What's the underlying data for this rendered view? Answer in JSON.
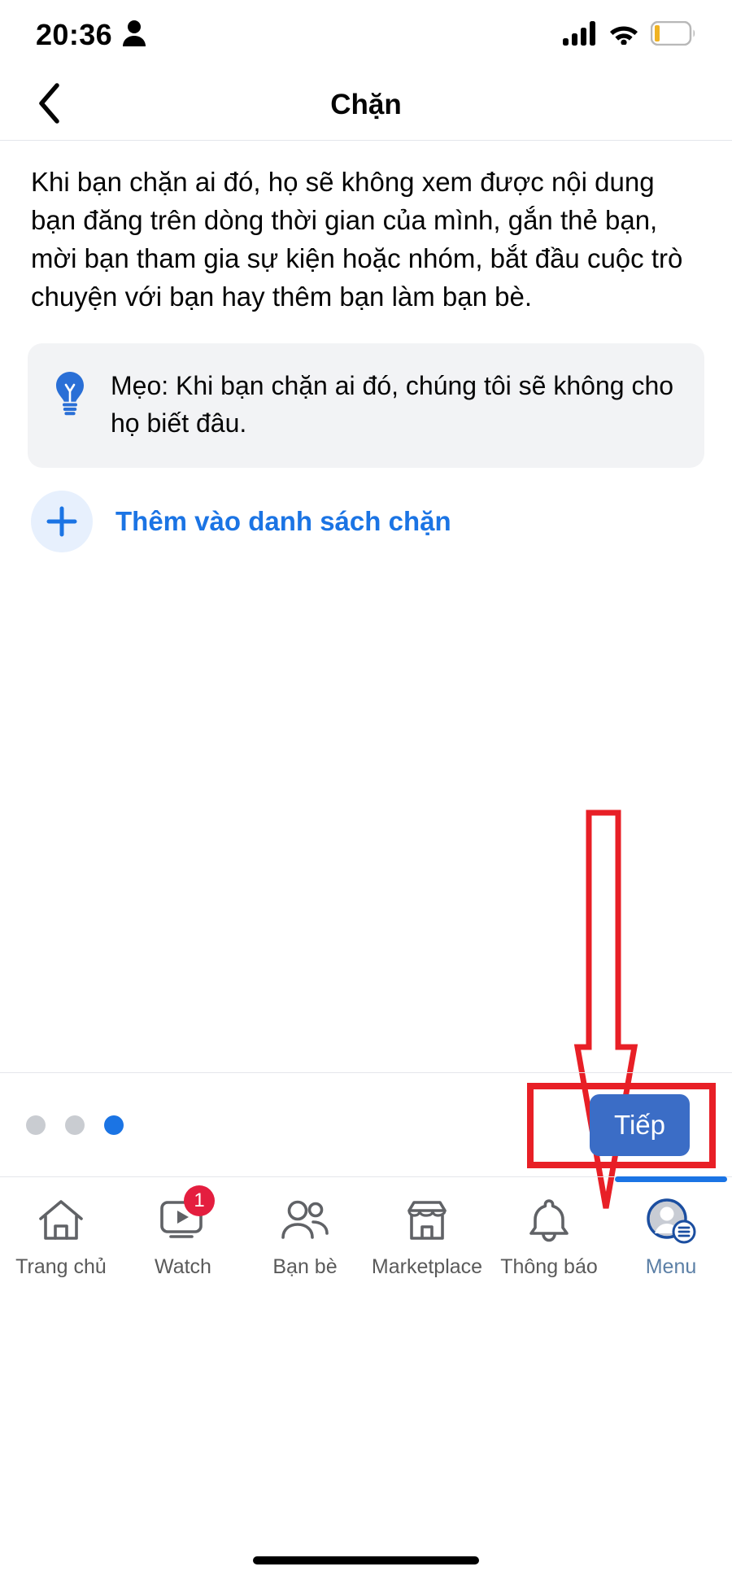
{
  "status_bar": {
    "time": "20:36",
    "person_icon": "person-filled-icon",
    "signal_icon": "cellular-signal-icon",
    "wifi_icon": "wifi-icon",
    "battery_icon": "battery-low-icon",
    "battery_color": "#f0b323"
  },
  "header": {
    "back_icon": "chevron-left-icon",
    "title": "Chặn"
  },
  "main": {
    "intro": "Khi bạn chặn ai đó, họ sẽ không xem được nội dung bạn đăng trên dòng thời gian của mình, gắn thẻ bạn, mời bạn tham gia sự kiện hoặc nhóm, bắt đầu cuộc trò chuyện với bạn hay thêm bạn làm bạn bè.",
    "tip": {
      "icon": "lightbulb-icon",
      "icon_color": "#2a6fd6",
      "text": "Mẹo: Khi bạn chặn ai đó, chúng tôi sẽ không cho họ biết đâu."
    },
    "add_to_blocklist": {
      "icon": "plus-icon",
      "label": "Thêm vào danh sách chặn",
      "accent_color": "#1b74e4"
    }
  },
  "annotations": {
    "arrow_color": "#e81f26",
    "box_color": "#e81f26",
    "arrow_name": "red-down-arrow-annotation",
    "box_target": "next-button"
  },
  "footer": {
    "pager": {
      "total": 3,
      "active_index": 2,
      "inactive_color": "#c9ccd1",
      "active_color": "#1b74e4"
    },
    "next_label": "Tiếp",
    "next_color": "#3b6dc6"
  },
  "tabbar": {
    "active_index": 5,
    "items": [
      {
        "label": "Trang chủ",
        "icon": "home-icon",
        "badge": null
      },
      {
        "label": "Watch",
        "icon": "watch-video-icon",
        "badge": "1"
      },
      {
        "label": "Bạn bè",
        "icon": "friends-icon",
        "badge": null
      },
      {
        "label": "Marketplace",
        "icon": "marketplace-store-icon",
        "badge": null
      },
      {
        "label": "Thông báo",
        "icon": "bell-notification-icon",
        "badge": null
      },
      {
        "label": "Menu",
        "icon": "menu-avatar-icon",
        "badge": null
      }
    ]
  }
}
